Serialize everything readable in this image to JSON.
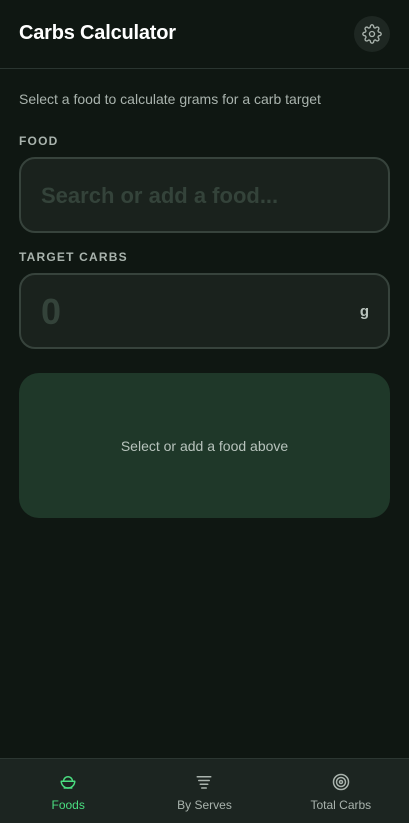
{
  "header": {
    "title": "Carbs Calculator"
  },
  "settings": {
    "icon": "gear-icon"
  },
  "subtitle": "Select a food to calculate grams for a carb target",
  "food": {
    "label": "FOOD",
    "placeholder": "Search or add a food..."
  },
  "target": {
    "label": "TARGET CARBS",
    "value": "0",
    "unit": "g"
  },
  "result": {
    "message": "Select or add a food above"
  },
  "nav": {
    "items": [
      {
        "label": "Foods",
        "icon": "bowl-icon",
        "active": true
      },
      {
        "label": "By Serves",
        "icon": "stack-icon",
        "active": false
      },
      {
        "label": "Total Carbs",
        "icon": "target-icon",
        "active": false
      }
    ]
  },
  "colors": {
    "accent": "#4ade80",
    "background": "#0f1712",
    "card": "#1f3829"
  }
}
